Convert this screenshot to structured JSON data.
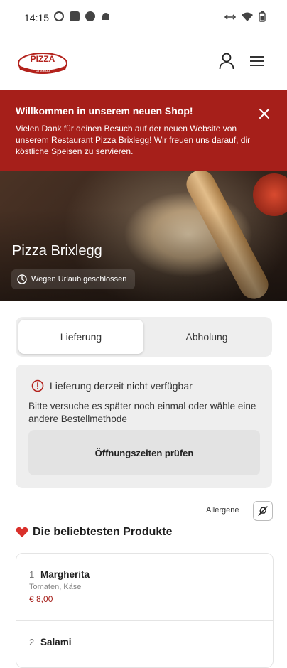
{
  "status_bar": {
    "time": "14:15",
    "left_icons": [
      "circle-icon",
      "square-icon",
      "record-icon",
      "android-icon"
    ],
    "right_icons": [
      "link-icon",
      "wifi-icon",
      "battery-icon"
    ]
  },
  "header": {
    "logo_text": "PIZZA",
    "logo_subtext": "Brixlegg",
    "account_icon": "user-icon",
    "menu_icon": "hamburger-icon"
  },
  "banner": {
    "title": "Willkommen in unserem neuen Shop!",
    "text": "Vielen Dank für deinen Besuch auf der neuen Website von unserem Restaurant Pizza Brixlegg! Wir freuen uns darauf, dir köstliche Speisen zu servieren.",
    "close_icon": "close-icon",
    "color": "#a61f1a"
  },
  "hero": {
    "title": "Pizza Brixlegg",
    "status": "Wegen Urlaub geschlossen"
  },
  "order_modes": {
    "tabs": [
      {
        "label": "Lieferung",
        "active": true
      },
      {
        "label": "Abholung",
        "active": false
      }
    ]
  },
  "notice": {
    "title": "Lieferung derzeit nicht verfügbar",
    "body": "Bitte versuche es später noch einmal oder wähle eine andere Bestellmethode",
    "button": "Öffnungszeiten prüfen"
  },
  "allergens": {
    "label": "Allergene"
  },
  "popular": {
    "title": "Die beliebtesten Produkte",
    "products": [
      {
        "index": "1",
        "name": "Margherita",
        "description": "Tomaten, Käse",
        "price": "€ 8,00"
      },
      {
        "index": "2",
        "name": "Salami",
        "description": "",
        "price": ""
      }
    ]
  }
}
